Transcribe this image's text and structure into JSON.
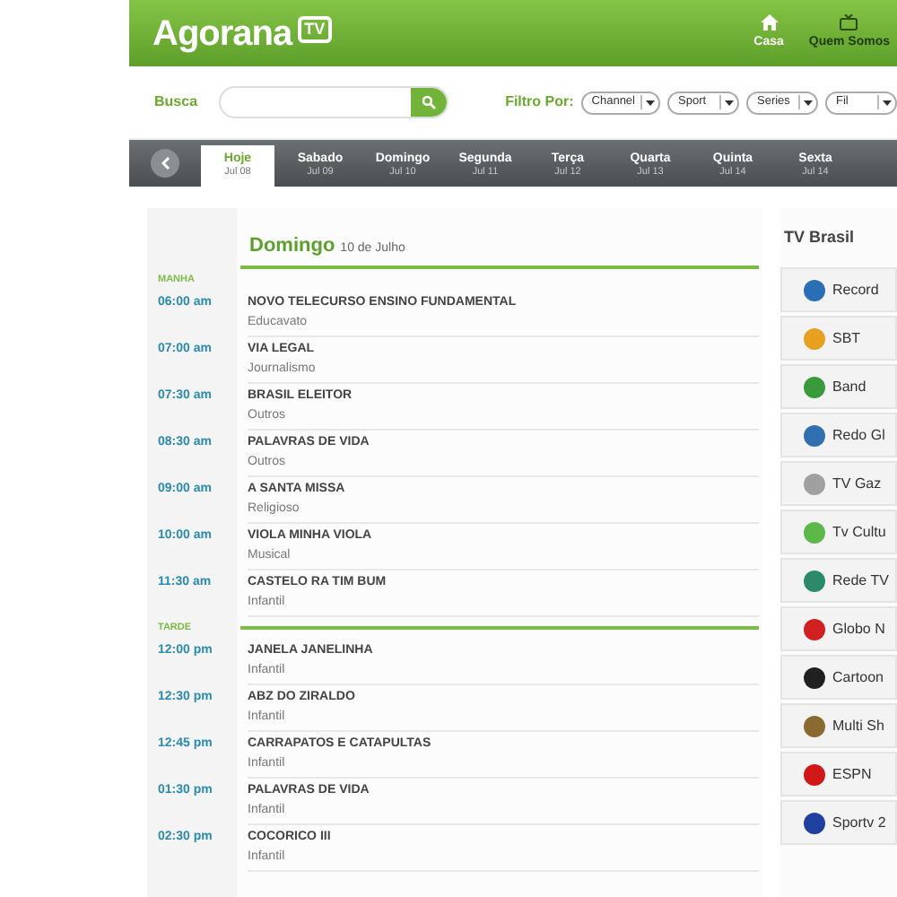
{
  "header": {
    "logo": "Agorana",
    "logo_badge": "TV",
    "nav": [
      {
        "label": "Casa",
        "kind": "home"
      },
      {
        "label": "Quem Somos",
        "kind": "tv"
      }
    ]
  },
  "search": {
    "label": "Busca"
  },
  "filters": {
    "label": "Filtro Por:",
    "dropdowns": [
      "Channel",
      "Sport",
      "Series",
      "Fil"
    ]
  },
  "days": [
    {
      "name": "Hoje",
      "date": "Jul 08",
      "selected": true
    },
    {
      "name": "Sabado",
      "date": "Jul 09",
      "selected": false
    },
    {
      "name": "Domingo",
      "date": "Jul 10",
      "selected": false
    },
    {
      "name": "Segunda",
      "date": "Jul 11",
      "selected": false
    },
    {
      "name": "Terça",
      "date": "Jul 12",
      "selected": false
    },
    {
      "name": "Quarta",
      "date": "Jul 13",
      "selected": false
    },
    {
      "name": "Quinta",
      "date": "Jul 14",
      "selected": false
    },
    {
      "name": "Sexta",
      "date": "Jul 14",
      "selected": false
    }
  ],
  "schedule": {
    "day": "Domingo",
    "date": "10 de Julho",
    "sections": [
      {
        "label": "MANHA",
        "items": [
          {
            "time": "06:00 am",
            "title": "NOVO TELECURSO ENSINO FUNDAMENTAL",
            "category": "Educavato"
          },
          {
            "time": "07:00 am",
            "title": "VIA LEGAL",
            "category": "Journalismo"
          },
          {
            "time": "07:30 am",
            "title": "BRASIL ELEITOR",
            "category": "Outros"
          },
          {
            "time": "08:30 am",
            "title": "PALAVRAS DE VIDA",
            "category": "Outros"
          },
          {
            "time": "09:00 am",
            "title": "A SANTA MISSA",
            "category": "Religioso"
          },
          {
            "time": "10:00 am",
            "title": "VIOLA MINHA VIOLA",
            "category": "Musical"
          },
          {
            "time": "11:30 am",
            "title": "CASTELO RA TIM BUM",
            "category": "Infantil"
          }
        ]
      },
      {
        "label": "TARDE",
        "items": [
          {
            "time": "12:00 pm",
            "title": "JANELA JANELINHA",
            "category": "Infantil"
          },
          {
            "time": "12:30 pm",
            "title": "ABZ DO ZIRALDO",
            "category": "Infantil"
          },
          {
            "time": "12:45 pm",
            "title": "CARRAPATOS E CATAPULTAS",
            "category": "Infantil"
          },
          {
            "time": "01:30 pm",
            "title": "PALAVRAS DE VIDA",
            "category": "Infantil"
          },
          {
            "time": "02:30 pm",
            "title": "COCORICO III",
            "category": "Infantil"
          }
        ]
      }
    ]
  },
  "channels": {
    "title": "TV Brasil",
    "items": [
      {
        "name": "Record",
        "color": "#2a6fb5"
      },
      {
        "name": "SBT",
        "color": "#e8a020"
      },
      {
        "name": "Band",
        "color": "#3a9a3a"
      },
      {
        "name": "Redo Gl",
        "color": "#3070b0"
      },
      {
        "name": "TV Gaz",
        "color": "#a0a0a0"
      },
      {
        "name": "Tv Cultu",
        "color": "#5cb848"
      },
      {
        "name": "Rede TV",
        "color": "#2a8a6a"
      },
      {
        "name": "Globo N",
        "color": "#d02020"
      },
      {
        "name": "Cartoon",
        "color": "#202020"
      },
      {
        "name": "Multi Sh",
        "color": "#8a6a30"
      },
      {
        "name": "ESPN",
        "color": "#d01818"
      },
      {
        "name": "Sportv 2",
        "color": "#2040a0"
      }
    ]
  }
}
